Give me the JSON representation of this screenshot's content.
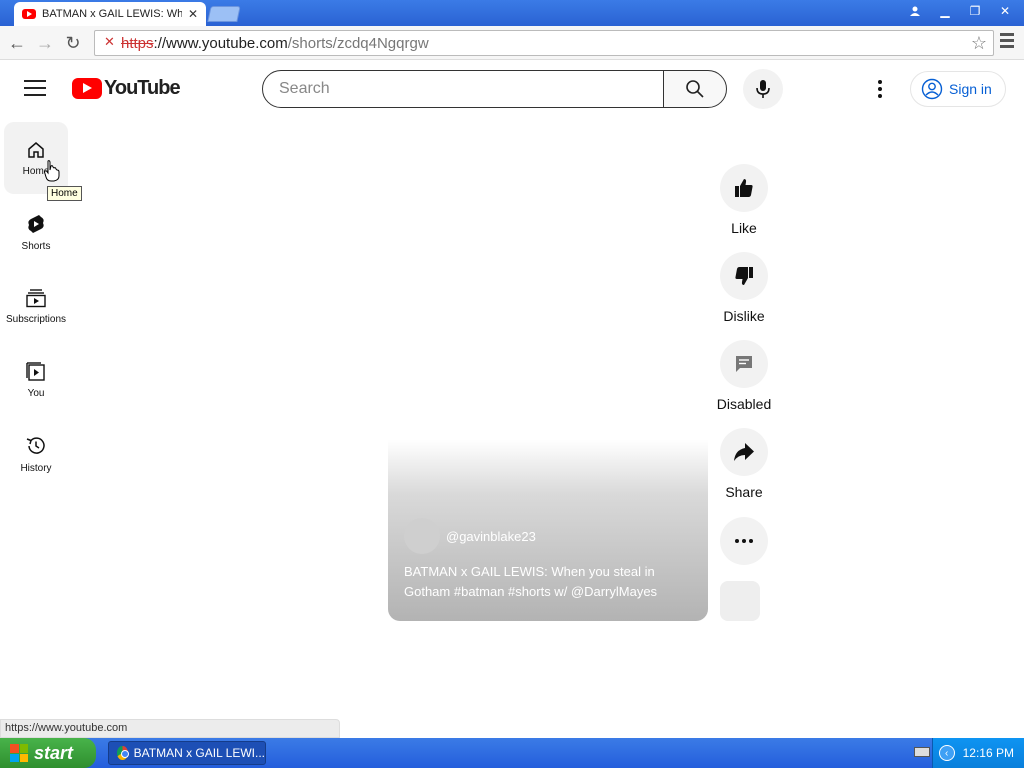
{
  "browser": {
    "tab_title": "BATMAN x GAIL LEWIS: Whe",
    "url_scheme": "https",
    "url_host": "://www.youtube.com",
    "url_path": "/shorts/zcdq4Ngqrgw"
  },
  "masthead": {
    "logo_text": "YouTube",
    "search_placeholder": "Search",
    "signin_label": "Sign in"
  },
  "guide": {
    "items": [
      {
        "label": "Home"
      },
      {
        "label": "Shorts"
      },
      {
        "label": "Subscriptions"
      },
      {
        "label": "You"
      },
      {
        "label": "History"
      }
    ],
    "tooltip": "Home"
  },
  "short": {
    "channel_handle": "@gavinblake23",
    "title": "BATMAN x GAIL LEWIS: When you steal in Gotham #batman #shorts w/ @DarrylMayes"
  },
  "actions": {
    "like_label": "Like",
    "dislike_label": "Dislike",
    "comments_label": "Disabled",
    "share_label": "Share"
  },
  "status_url": "https://www.youtube.com",
  "taskbar": {
    "start_label": "start",
    "task_label": "BATMAN x GAIL LEWI...",
    "clock": "12:16 PM"
  }
}
